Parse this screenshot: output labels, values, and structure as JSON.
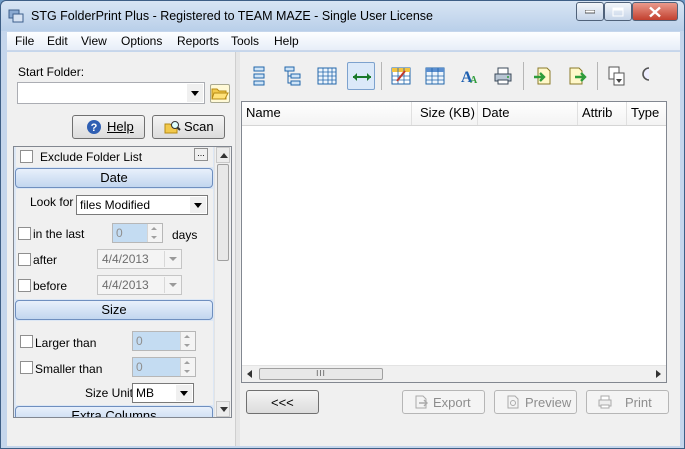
{
  "window": {
    "title": "STG FolderPrint Plus - Registered to TEAM MAZE - Single User License"
  },
  "menu": [
    "File",
    "Edit",
    "View",
    "Options",
    "Reports",
    "Tools",
    "Help"
  ],
  "left": {
    "start_folder_label": "Start Folder:",
    "start_folder_value": "",
    "help_label": "Help",
    "scan_label": "Scan",
    "exclude_label": "Exclude Folder List",
    "exclude_btn": "...",
    "date": {
      "header": "Date",
      "look_for_label": "Look for",
      "look_for_value": "files Modified",
      "in_last_label": "in the last",
      "in_last_value": "0",
      "days_label": "days",
      "after_label": "after",
      "after_value": "4/4/2013",
      "before_label": "before",
      "before_value": "4/4/2013"
    },
    "size": {
      "header": "Size",
      "larger_label": "Larger than",
      "larger_value": "0",
      "smaller_label": "Smaller than",
      "smaller_value": "0",
      "unit_label": "Size Unit",
      "unit_value": "MB"
    },
    "extra_header": "Extra Columns"
  },
  "list": {
    "columns": [
      "Name",
      "Size (KB)",
      "Date",
      "Attrib",
      "Type"
    ],
    "scroll_grip": "III"
  },
  "buttons": {
    "back": "<<<",
    "export": "Export",
    "preview": "Preview",
    "print": "Print"
  }
}
